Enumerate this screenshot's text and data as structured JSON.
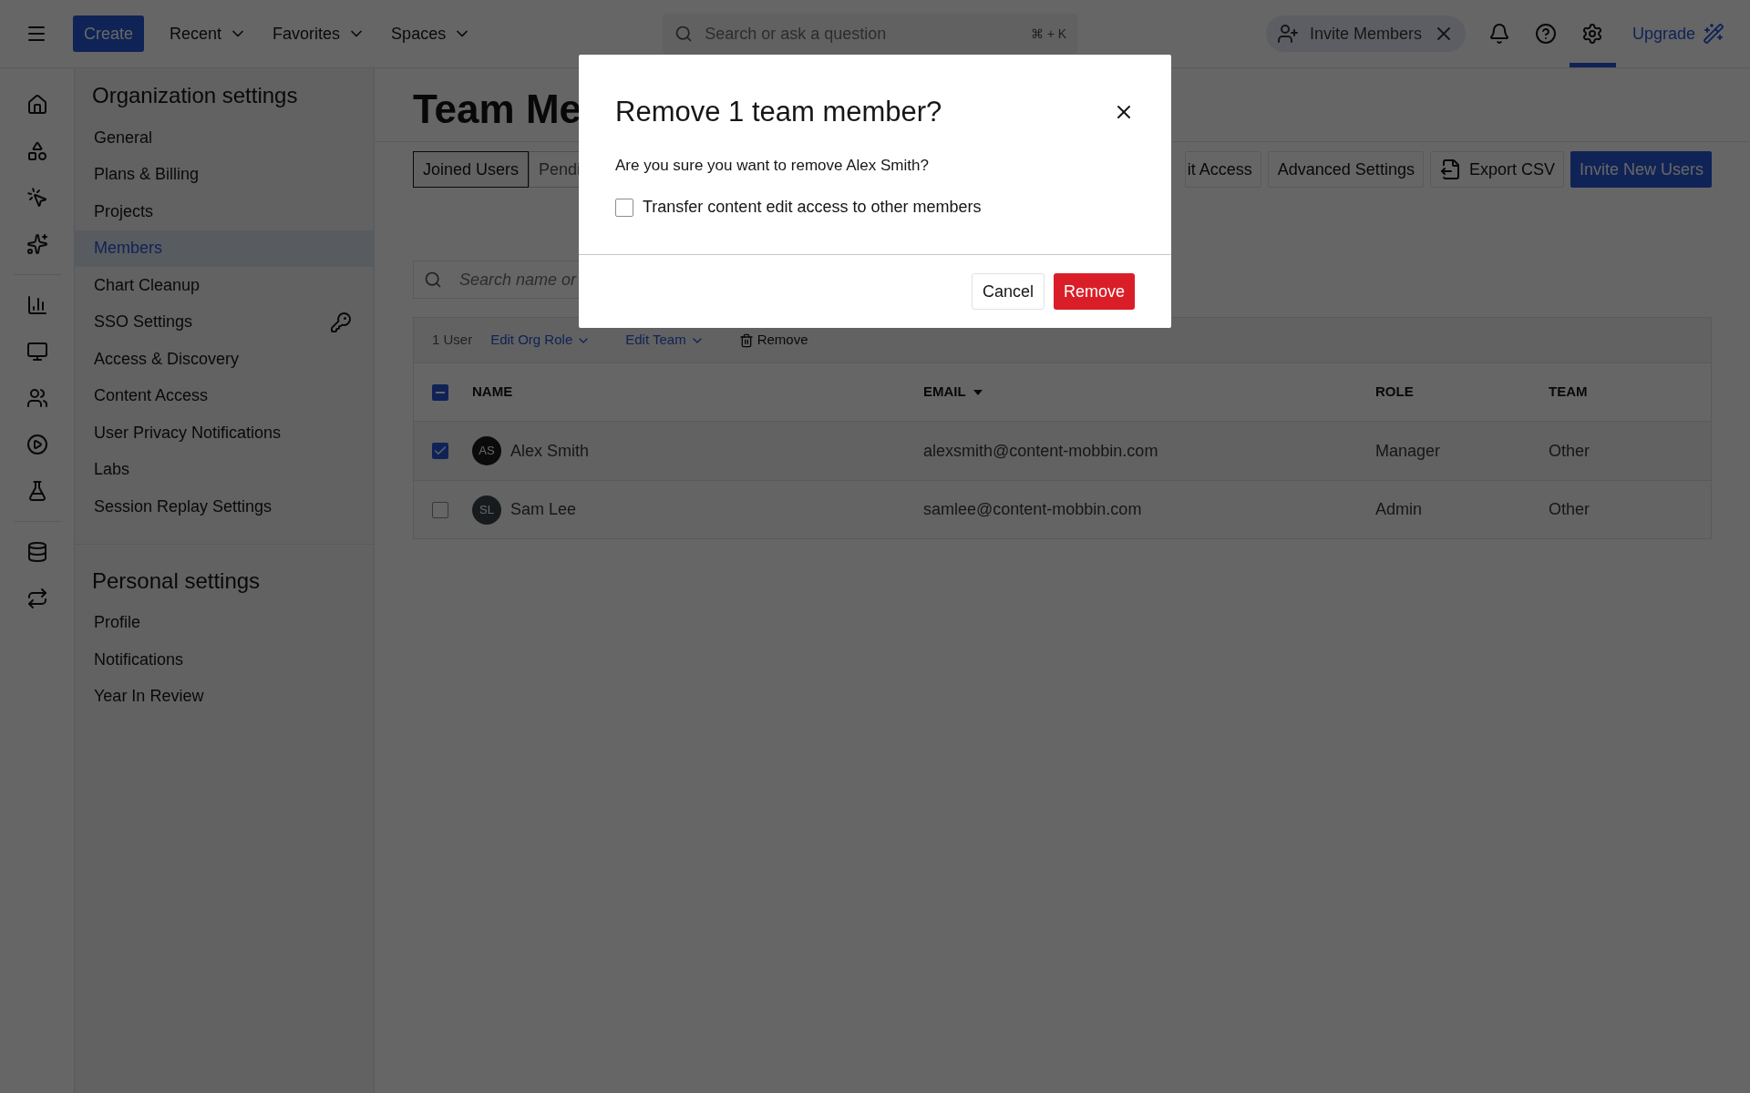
{
  "top_bar": {
    "create": "Create",
    "nav": [
      {
        "label": "Recent"
      },
      {
        "label": "Favorites"
      },
      {
        "label": "Spaces"
      }
    ],
    "search": {
      "placeholder": "Search or ask a question",
      "shortcut": "⌘ + K"
    },
    "invite_chip": "Invite Members",
    "icons": [
      {
        "kind": "bell",
        "selected": false
      },
      {
        "kind": "help",
        "selected": false
      },
      {
        "kind": "settings",
        "selected": true
      }
    ],
    "upgrade": "Upgrade"
  },
  "rail": [
    {
      "kind": "home"
    },
    {
      "kind": "shapes"
    },
    {
      "kind": "click"
    },
    {
      "kind": "sparkles"
    },
    {
      "kind": "divider"
    },
    {
      "kind": "chart"
    },
    {
      "kind": "monitor"
    },
    {
      "kind": "users"
    },
    {
      "kind": "play"
    },
    {
      "kind": "flask"
    },
    {
      "kind": "divider"
    },
    {
      "kind": "database"
    },
    {
      "kind": "swap"
    }
  ],
  "sidebar": [
    {
      "title": "Organization settings",
      "items": [
        {
          "label": "General",
          "selected": false,
          "key_icon": false
        },
        {
          "label": "Plans & Billing",
          "selected": false,
          "key_icon": false
        },
        {
          "label": "Projects",
          "selected": false,
          "key_icon": false
        },
        {
          "label": "Members",
          "selected": true,
          "key_icon": false
        },
        {
          "label": "Chart Cleanup",
          "selected": false,
          "key_icon": false
        },
        {
          "label": "SSO Settings",
          "selected": false,
          "key_icon": true
        },
        {
          "label": "Access & Discovery",
          "selected": false,
          "key_icon": false
        },
        {
          "label": "Content Access",
          "selected": false,
          "key_icon": false
        },
        {
          "label": "User Privacy Notifications",
          "selected": false,
          "key_icon": false
        },
        {
          "label": "Labs",
          "selected": false,
          "key_icon": false
        },
        {
          "label": "Session Replay Settings",
          "selected": false,
          "key_icon": false
        }
      ]
    },
    {
      "title": "Personal settings",
      "items": [
        {
          "label": "Profile",
          "selected": false,
          "key_icon": false
        },
        {
          "label": "Notifications",
          "selected": false,
          "key_icon": false
        },
        {
          "label": "Year In Review",
          "selected": false,
          "key_icon": false
        }
      ]
    }
  ],
  "main": {
    "title": "Team Me",
    "tabs": [
      {
        "label": "Joined Users",
        "selected": true
      },
      {
        "label": "Pendi",
        "selected": false
      }
    ],
    "actions": [
      {
        "label": "it Access",
        "kind": "plain"
      },
      {
        "label": "Advanced Settings",
        "kind": "plain"
      },
      {
        "label": "Export CSV",
        "kind": "export"
      },
      {
        "label": "Invite New Users",
        "kind": "primary"
      }
    ],
    "search": {
      "placeholder": "Search name or"
    },
    "bulk": {
      "count": "1 User",
      "actions": [
        {
          "label": "Edit Org Role",
          "kind": "dropdown"
        },
        {
          "label": "Edit Team",
          "kind": "dropdown"
        },
        {
          "label": "Remove",
          "kind": "delete"
        }
      ]
    },
    "table": {
      "select_all_partial": true,
      "columns": [
        {
          "label": "NAME",
          "sorted": false
        },
        {
          "label": "EMAIL",
          "sorted": true
        },
        {
          "label": "ROLE",
          "sorted": false
        },
        {
          "label": "TEAM",
          "sorted": false
        }
      ],
      "rows": [
        {
          "initials": "AS",
          "color": "#1c1c1c",
          "name": "Alex Smith",
          "email": "alexsmith@content-mobbin.com",
          "role": "Manager",
          "team": "Other",
          "selected": true
        },
        {
          "initials": "SL",
          "color": "#3b4549",
          "name": "Sam Lee",
          "email": "samlee@content-mobbin.com",
          "role": "Admin",
          "team": "Other",
          "selected": false
        }
      ]
    }
  },
  "dialog": {
    "title": "Remove 1 team member?",
    "message": "Are you sure you want to remove Alex Smith?",
    "checkbox": {
      "label": "Transfer content edit access to other members",
      "checked": false
    },
    "buttons": [
      {
        "label": "Cancel",
        "kind": "secondary"
      },
      {
        "label": "Remove",
        "kind": "danger"
      }
    ]
  }
}
